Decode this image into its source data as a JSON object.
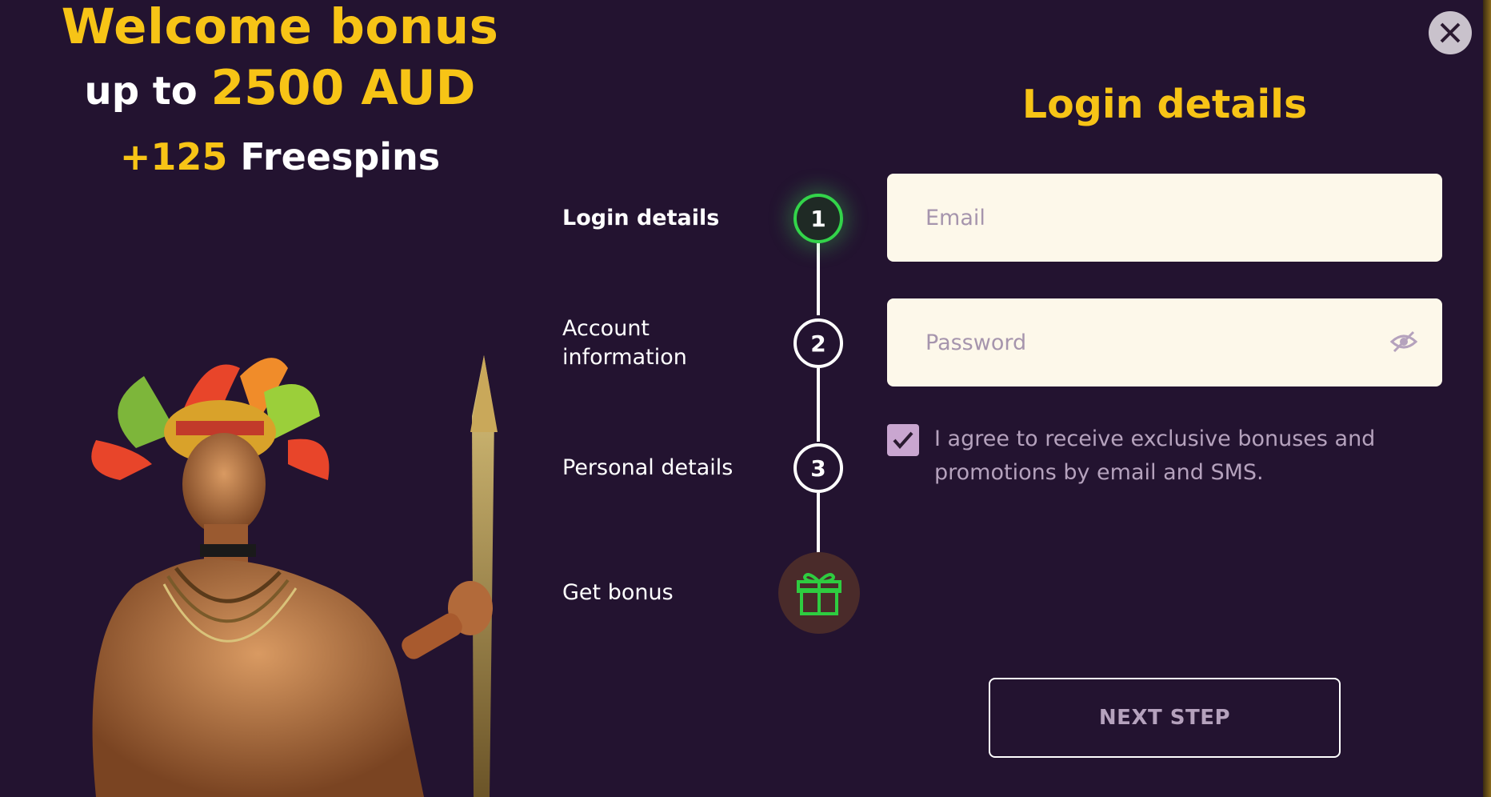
{
  "promo": {
    "headline": "Welcome bonus",
    "up_to": "up to",
    "amount": "2500 AUD",
    "freespins_count": "+125",
    "freespins_label": "Freespins"
  },
  "stepper": {
    "steps": [
      {
        "label": "Login details",
        "number": "1"
      },
      {
        "label_line1": "Account",
        "label_line2": "information",
        "number": "2"
      },
      {
        "label": "Personal details",
        "number": "3"
      },
      {
        "label": "Get bonus",
        "icon": "gift-icon"
      }
    ],
    "active_step": 1
  },
  "form": {
    "title": "Login details",
    "email": {
      "placeholder": "Email",
      "value": ""
    },
    "password": {
      "placeholder": "Password",
      "value": ""
    },
    "consent": {
      "checked": true,
      "text": "I agree to receive exclusive bonuses and promotions by email and SMS."
    },
    "next_button": "NEXT STEP"
  },
  "colors": {
    "background": "#231330",
    "accent_yellow": "#f7c416",
    "active_green": "#33d44a",
    "field_bg": "#fdf8ea",
    "muted_text": "#b5a2bd"
  },
  "icons": {
    "close": "close-icon",
    "password_toggle": "eye-slash-icon",
    "checkbox": "checkmark-icon",
    "bonus": "gift-icon"
  }
}
